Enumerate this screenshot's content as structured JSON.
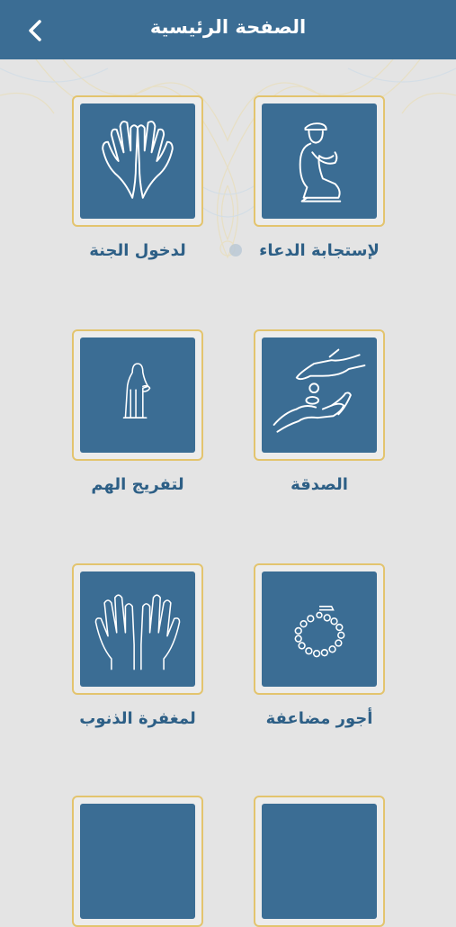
{
  "header": {
    "title": "الصفحة الرئيسية",
    "back_icon": "chevron-left-icon"
  },
  "colors": {
    "primary": "#3b6d94",
    "gold": "#e3c46e",
    "background": "#e4e4e4"
  },
  "tiles": [
    {
      "label": "لإستجابة الدعاء",
      "icon": "kneeling-prayer-icon"
    },
    {
      "label": "لدخول الجنة",
      "icon": "raised-hands-icon"
    },
    {
      "label": "الصدقة",
      "icon": "giving-hands-icon"
    },
    {
      "label": "لتفريج الهم",
      "icon": "praying-woman-icon"
    },
    {
      "label": "أجور مضاعفة",
      "icon": "prayer-beads-icon"
    },
    {
      "label": "لمغفرة الذنوب",
      "icon": "open-palms-icon"
    },
    {
      "label": "",
      "icon": "partial-tile"
    },
    {
      "label": "",
      "icon": "partial-tile"
    }
  ]
}
